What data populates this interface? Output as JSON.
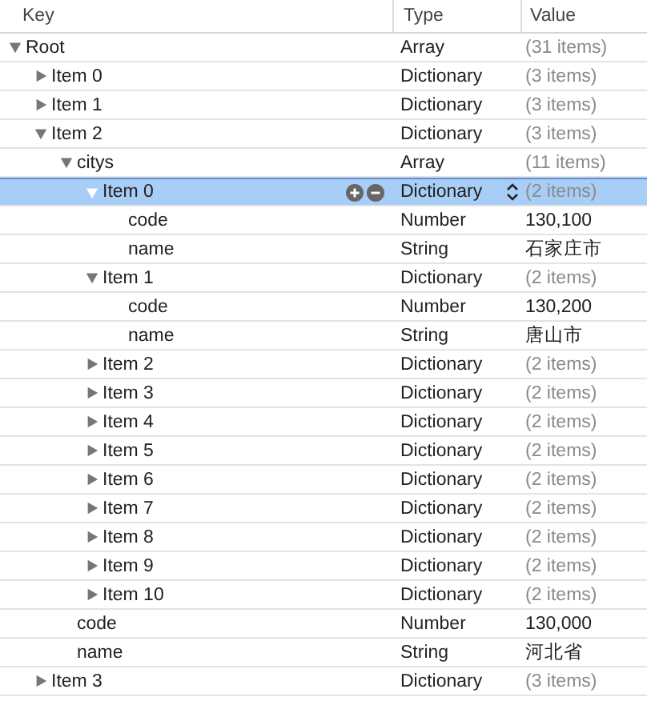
{
  "columns": [
    {
      "label": "Key"
    },
    {
      "label": "Type"
    },
    {
      "label": "Value"
    }
  ],
  "rows": [
    {
      "key": "Root",
      "type": "Array",
      "value": "(31 items)",
      "kind": "branch",
      "expanded": true,
      "selected": false,
      "children": [
        {
          "key": "Item 0",
          "type": "Dictionary",
          "value": "(3 items)",
          "kind": "branch",
          "expanded": false,
          "selected": false
        },
        {
          "key": "Item 1",
          "type": "Dictionary",
          "value": "(3 items)",
          "kind": "branch",
          "expanded": false,
          "selected": false
        },
        {
          "key": "Item 2",
          "type": "Dictionary",
          "value": "(3 items)",
          "kind": "branch",
          "expanded": true,
          "selected": false,
          "children": [
            {
              "key": "citys",
              "type": "Array",
              "value": "(11 items)",
              "kind": "branch",
              "expanded": true,
              "selected": false,
              "children": [
                {
                  "key": "Item 0",
                  "type": "Dictionary",
                  "value": "(2 items)",
                  "kind": "branch",
                  "expanded": true,
                  "selected": true,
                  "children": [
                    {
                      "key": "code",
                      "type": "Number",
                      "value": "130,100",
                      "kind": "leaf",
                      "selected": false
                    },
                    {
                      "key": "name",
                      "type": "String",
                      "value": "石家庄市",
                      "kind": "leaf",
                      "selected": false
                    }
                  ]
                },
                {
                  "key": "Item 1",
                  "type": "Dictionary",
                  "value": "(2 items)",
                  "kind": "branch",
                  "expanded": true,
                  "selected": false,
                  "children": [
                    {
                      "key": "code",
                      "type": "Number",
                      "value": "130,200",
                      "kind": "leaf",
                      "selected": false
                    },
                    {
                      "key": "name",
                      "type": "String",
                      "value": "唐山市",
                      "kind": "leaf",
                      "selected": false
                    }
                  ]
                },
                {
                  "key": "Item 2",
                  "type": "Dictionary",
                  "value": "(2 items)",
                  "kind": "branch",
                  "expanded": false,
                  "selected": false
                },
                {
                  "key": "Item 3",
                  "type": "Dictionary",
                  "value": "(2 items)",
                  "kind": "branch",
                  "expanded": false,
                  "selected": false
                },
                {
                  "key": "Item 4",
                  "type": "Dictionary",
                  "value": "(2 items)",
                  "kind": "branch",
                  "expanded": false,
                  "selected": false
                },
                {
                  "key": "Item 5",
                  "type": "Dictionary",
                  "value": "(2 items)",
                  "kind": "branch",
                  "expanded": false,
                  "selected": false
                },
                {
                  "key": "Item 6",
                  "type": "Dictionary",
                  "value": "(2 items)",
                  "kind": "branch",
                  "expanded": false,
                  "selected": false
                },
                {
                  "key": "Item 7",
                  "type": "Dictionary",
                  "value": "(2 items)",
                  "kind": "branch",
                  "expanded": false,
                  "selected": false
                },
                {
                  "key": "Item 8",
                  "type": "Dictionary",
                  "value": "(2 items)",
                  "kind": "branch",
                  "expanded": false,
                  "selected": false
                },
                {
                  "key": "Item 9",
                  "type": "Dictionary",
                  "value": "(2 items)",
                  "kind": "branch",
                  "expanded": false,
                  "selected": false
                },
                {
                  "key": "Item 10",
                  "type": "Dictionary",
                  "value": "(2 items)",
                  "kind": "branch",
                  "expanded": false,
                  "selected": false
                }
              ]
            },
            {
              "key": "code",
              "type": "Number",
              "value": "130,000",
              "kind": "leaf",
              "selected": false
            },
            {
              "key": "name",
              "type": "String",
              "value": "河北省",
              "kind": "leaf",
              "selected": false
            }
          ]
        },
        {
          "key": "Item 3",
          "type": "Dictionary",
          "value": "(3 items)",
          "kind": "branch",
          "expanded": false,
          "selected": false
        }
      ]
    }
  ]
}
